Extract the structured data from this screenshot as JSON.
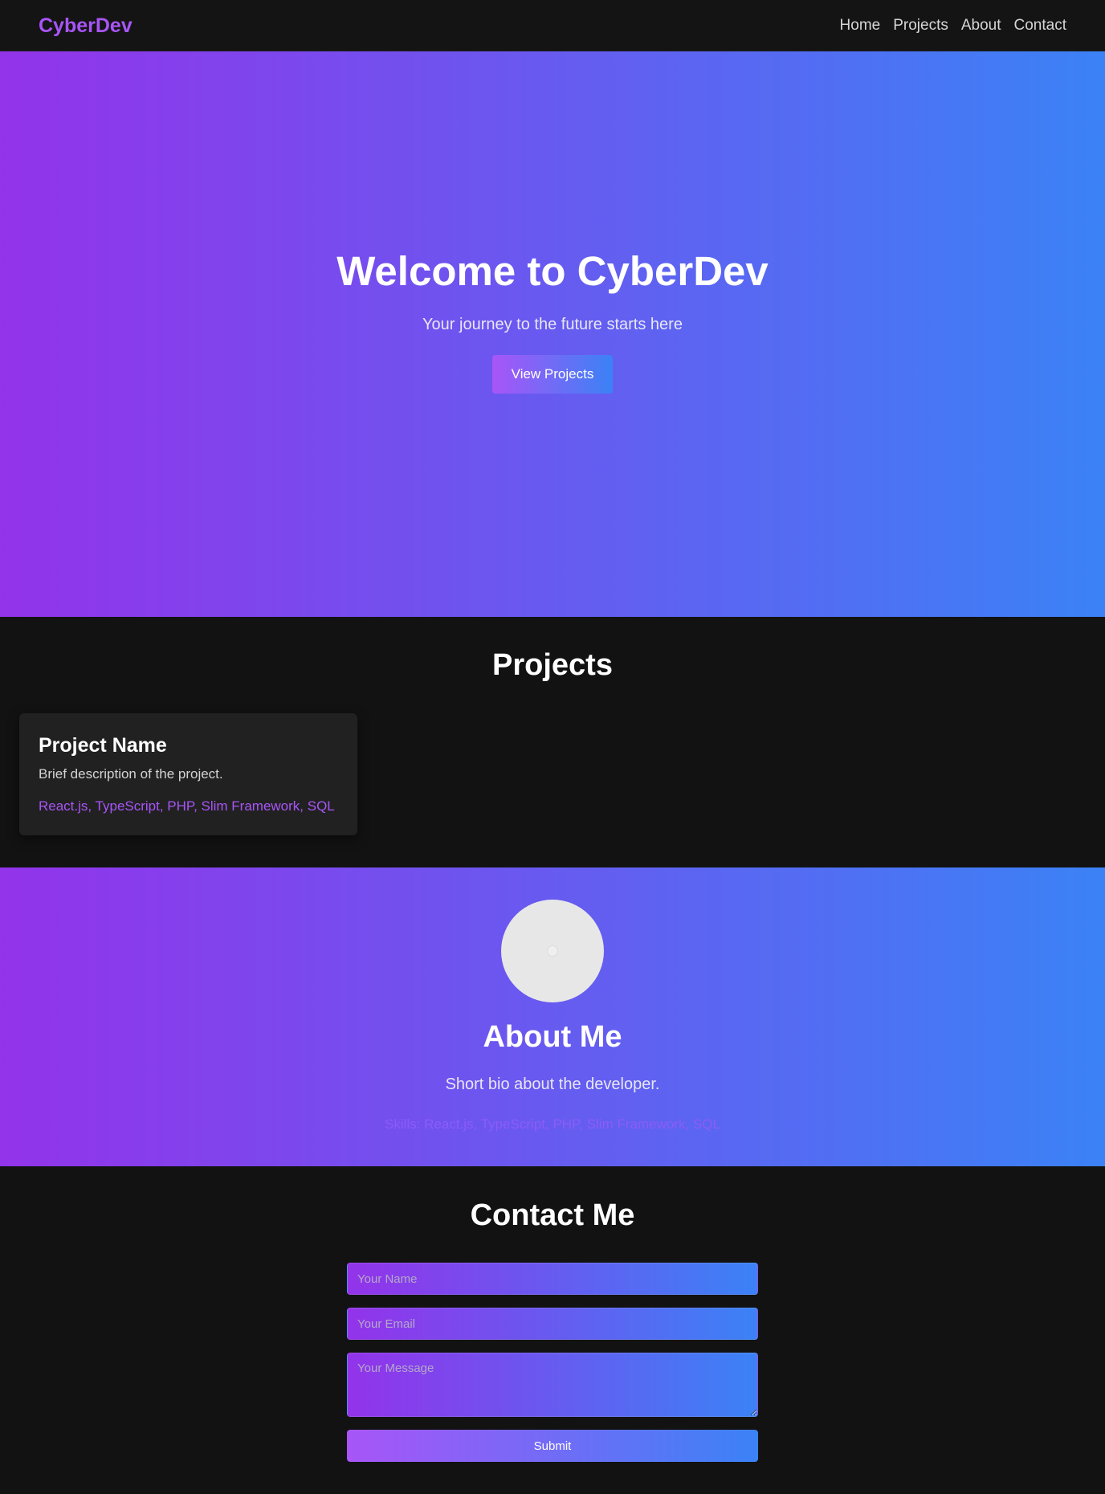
{
  "navbar": {
    "brand": "CyberDev",
    "links": [
      "Home",
      "Projects",
      "About",
      "Contact"
    ]
  },
  "hero": {
    "title": "Welcome to CyberDev",
    "subtitle": "Your journey to the future starts here",
    "button_label": "View Projects"
  },
  "projects": {
    "title": "Projects",
    "items": [
      {
        "name": "Project Name",
        "description": "Brief description of the project.",
        "tech": "React.js, TypeScript, PHP, Slim Framework, SQL"
      }
    ]
  },
  "about": {
    "title": "About Me",
    "bio": "Short bio about the developer.",
    "skills": "Skills: React.js, TypeScript, PHP, Slim Framework, SQL"
  },
  "contact": {
    "title": "Contact Me",
    "name_placeholder": "Your Name",
    "email_placeholder": "Your Email",
    "message_placeholder": "Your Message",
    "submit_label": "Submit"
  },
  "colors": {
    "accent_purple": "#9333ea",
    "accent_blue": "#3b82f6",
    "brand_purple": "#a855f7",
    "background": "#121212",
    "card": "#212121"
  },
  "icons": {
    "avatar": "avatar-placeholder-icon"
  }
}
